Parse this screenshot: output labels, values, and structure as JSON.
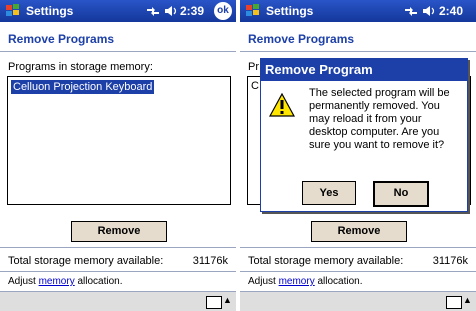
{
  "left_screen": {
    "title": "Settings",
    "time": "2:39",
    "ok_label": "ok",
    "page_title": "Remove Programs",
    "list_caption": "Programs in storage memory:",
    "programs": [
      "Celluon Projection Keyboard"
    ],
    "remove_label": "Remove",
    "memory_label": "Total storage memory available:",
    "memory_value": "31176k",
    "adjust_prefix": "Adjust ",
    "adjust_link": "memory",
    "adjust_suffix": " allocation."
  },
  "right_screen": {
    "title": "Settings",
    "time": "2:40",
    "page_title": "Remove Programs",
    "list_caption_visible": "Pr",
    "list_item_visible": "C",
    "remove_label": "Remove",
    "memory_label": "Total storage memory available:",
    "memory_value": "31176k",
    "adjust_prefix": "Adjust ",
    "adjust_link": "memory",
    "adjust_suffix": " allocation.",
    "dialog": {
      "title": "Remove Program",
      "message": "The selected program will be permanently removed. You may reload it from your desktop computer. Are you sure you want to remove it?",
      "yes_label": "Yes",
      "no_label": "No"
    }
  },
  "colors": {
    "title_bar": "#1c3fa8",
    "selection": "#1c3fa8",
    "button_face": "#e5dccd",
    "link": "#0000cc"
  },
  "icons": [
    "windows-start-icon",
    "signal-icon",
    "speaker-icon",
    "warning-icon",
    "keyboard-icon"
  ]
}
